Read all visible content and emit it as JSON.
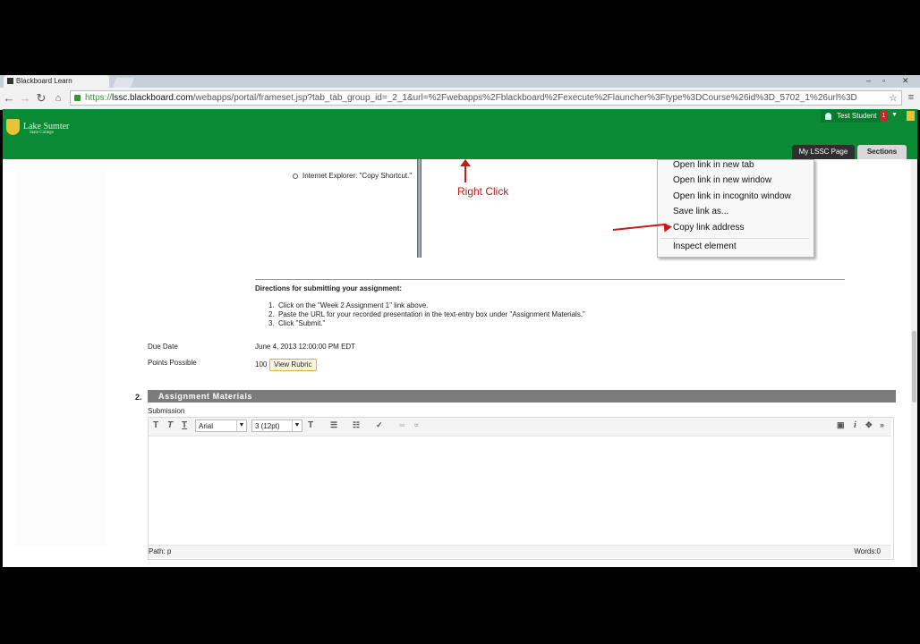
{
  "browser": {
    "tab_title": "Blackboard Learn",
    "url_scheme": "https://",
    "url_host": "lssc.blackboard.com",
    "url_path": "/webapps/portal/frameset.jsp?tab_tab_group_id=_2_1&url=%2Fwebapps%2Fblackboard%2Fexecute%2Flauncher%3Ftype%3DCourse%26id%3D_5702_1%26url%3D",
    "window_controls": [
      "–",
      "▫",
      "✕"
    ]
  },
  "header": {
    "logo_name": "Lake Sumter",
    "logo_sub": "State College",
    "user_name": "Test Student",
    "notification_count": "1",
    "tabs": [
      "My LSSC Page",
      "Sections"
    ],
    "bg_color": "#0a8a34"
  },
  "instructions": {
    "bullet": "Internet Explorer: \"Copy Shortcut.\"",
    "annotation": "Right Click",
    "directions_title": "Directions for submitting your assignment:",
    "steps": [
      "Click on the \"Week 2 Assignment 1\" link above.",
      "Paste the URL for your recorded presentation in the text-entry box under \"Assignment Materials.\"",
      "Click \"Submit.\""
    ]
  },
  "context_menu": {
    "items": [
      "Open link in new tab",
      "Open link in new window",
      "Open link in incognito window",
      "Save link as...",
      "Copy link address",
      "Inspect element"
    ],
    "highlighted": "Copy link address"
  },
  "details": {
    "due_label": "Due Date",
    "due_value": "June 4, 2013 12:00:00 PM EDT",
    "points_label": "Points Possible",
    "points_value": "100",
    "rubric_button": "View Rubric"
  },
  "assignment": {
    "section_number": "2.",
    "section_title": "Assignment Materials",
    "submission_label": "Submission",
    "font_value": "Arial",
    "size_value": "3 (12pt)",
    "path_label": "Path: p",
    "words_label": "Words:0"
  }
}
